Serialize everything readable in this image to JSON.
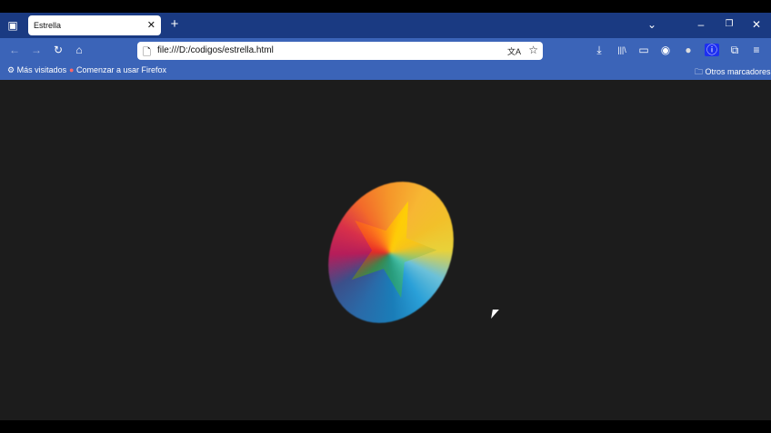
{
  "tab": {
    "title": "Estrella",
    "close": "✕",
    "new_tab": "+"
  },
  "window": {
    "list_all": "⌄",
    "minimize": "–",
    "restore": "❐",
    "close": "✕"
  },
  "toolbar": {
    "url": "file:///D:/codigos/estrella.html",
    "back": "←",
    "forward": "→",
    "reload": "↻",
    "home": "⌂",
    "translate": "文A",
    "bookmark": "☆"
  },
  "right_icons": {
    "downloads": "⤓",
    "library": "|||\\",
    "sidebar": "▭",
    "account": "◉",
    "extension_blob": "●",
    "extension_1": "ⓘ",
    "extensions": "⧉",
    "menu": "≡"
  },
  "bookmarks": {
    "most_visited": "Más visitados",
    "getting_started": "Comenzar a usar Firefox",
    "other": "Otros marcadores"
  }
}
